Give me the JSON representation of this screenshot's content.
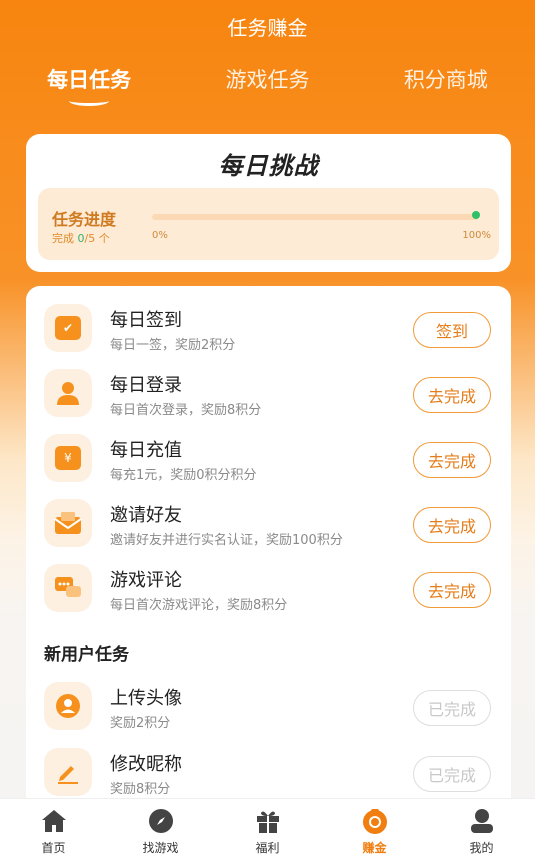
{
  "header": {
    "title": "任务赚金"
  },
  "tabs": [
    {
      "label": "每日任务",
      "active": true
    },
    {
      "label": "游戏任务",
      "active": false
    },
    {
      "label": "积分商城",
      "active": false
    }
  ],
  "challenge": {
    "title": "每日挑战",
    "progress_label": "任务进度",
    "count_prefix": "完成 ",
    "count_done": "0",
    "count_suffix": "/5 个",
    "pct_start": "0%",
    "pct_end": "100%",
    "progress_fraction": 0
  },
  "daily_tasks": [
    {
      "name": "每日签到",
      "desc": "每日一签，奖励2积分",
      "button": "签到",
      "icon": "calendar-check-icon",
      "done": false
    },
    {
      "name": "每日登录",
      "desc": "每日首次登录，奖励8积分",
      "button": "去完成",
      "icon": "user-icon",
      "done": false
    },
    {
      "name": "每日充值",
      "desc": "每充1元，奖励0积分积分",
      "button": "去完成",
      "icon": "wallet-icon",
      "done": false
    },
    {
      "name": "邀请好友",
      "desc": "邀请好友并进行实名认证，奖励100积分",
      "button": "去完成",
      "icon": "envelope-icon",
      "done": false
    },
    {
      "name": "游戏评论",
      "desc": "每日首次游戏评论，奖励8积分",
      "button": "去完成",
      "icon": "comment-icon",
      "done": false
    }
  ],
  "new_user_section": "新用户任务",
  "new_user_tasks": [
    {
      "name": "上传头像",
      "desc": "奖励2积分",
      "button": "已完成",
      "icon": "avatar-icon",
      "done": true
    },
    {
      "name": "修改昵称",
      "desc": "奖励8积分",
      "button": "已完成",
      "icon": "pencil-icon",
      "done": true
    }
  ],
  "nav": [
    {
      "label": "首页",
      "icon": "home-icon",
      "active": false
    },
    {
      "label": "找游戏",
      "icon": "compass-icon",
      "active": false
    },
    {
      "label": "福利",
      "icon": "gift-icon",
      "active": false
    },
    {
      "label": "赚金",
      "icon": "coin-bag-icon",
      "active": true
    },
    {
      "label": "我的",
      "icon": "profile-icon",
      "active": false
    }
  ],
  "colors": {
    "primary": "#f7850f",
    "accent_green": "#2fc068",
    "button_border": "#f19a3a"
  }
}
